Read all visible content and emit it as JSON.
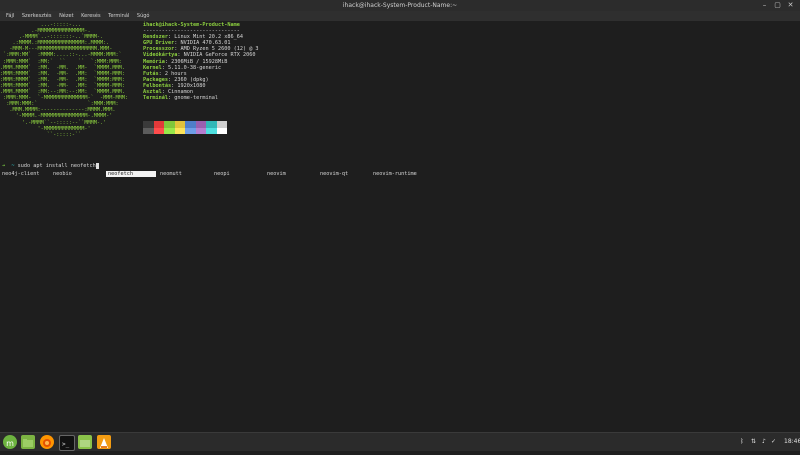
{
  "window": {
    "title": "ihack@ihack-System-Product-Name:~",
    "menu": [
      "Fájl",
      "Szerkesztés",
      "Nézet",
      "Keresés",
      "Terminál",
      "Súgó"
    ]
  },
  "neofetch": {
    "ascii_art": [
      "             ...-:::::-...",
      "          .-MMMMMMMMMMMMMMM-.",
      "      .-MMMM`..-:::::::-..`MMMM-.",
      "    .:MMMM.:MMMMMMMMMMMMMMM:.MMMM:.",
      "   -MMM-M---MMMMMMMMMMMMMMMMMMM.MMM-",
      " `:MMM:MM`  :MMMM:....::-...-MMMM:MMM:`",
      " :MMM:MMM`  :MM:`  ``    ``  `:MMM:MMM:",
      ".MMM.MMMM`  :MM.  -MM.  .MM-  `MMMM.MMM.",
      ":MMM:MMMM`  :MM.  -MM-  .MM:  `MMMM-MMM:",
      ":MMM:MMMM`  :MM.  -MM-  .MM:  `MMMM:MMM:",
      ":MMM:MMMM`  :MM.  -MM-  .MM:  `MMMM-MMM:",
      ".MMM.MMMM`  :MM:--:MM:--:MM:  `MMMM.MMM.",
      " :MMM:MMM-  `-MMMMMMMMMMMMMM-`  -MMM-MMM:",
      "  :MMM:MMM:`                `:MMM:MMM:",
      "   .MMM.MMMM:--------------:MMMM.MMM.",
      "     '-MMMM.-MMMMMMMMMMMMMMM-.MMMM-'",
      "       '.-MMMM``--:::::--``MMMM-.'",
      "            '-MMMMMMMMMMMMM-'",
      "               ``-:::::-``"
    ],
    "user_host": "ihack@ihack-System-Product-Name",
    "separator": "-------------------------------",
    "fields": [
      {
        "key": "Rendszer",
        "value": "Linux Mint 20.2 x86_64"
      },
      {
        "key": "GPU Driver",
        "value": "NVIDIA 470.63.01"
      },
      {
        "key": "Processzor",
        "value": "AMD Ryzen 5 2600 (12) @ 3"
      },
      {
        "key": "Videókártya",
        "value": "NVIDIA GeForce RTX 2060"
      },
      {
        "key": "Memória",
        "value": "2306MiB / 15928MiB"
      },
      {
        "key": "Kernel",
        "value": "5.11.0-38-generic"
      },
      {
        "key": "Futás",
        "value": "2 hours"
      },
      {
        "key": "Packages",
        "value": "2360 (dpkg)"
      },
      {
        "key": "Felbontás",
        "value": "1920x1080"
      },
      {
        "key": "Asztal",
        "value": "Cinnamon"
      },
      {
        "key": "Terminál",
        "value": "gnome-terminal"
      }
    ],
    "palette_top": [
      "#3a3a3a",
      "#e23a3a",
      "#7fc73b",
      "#e1c23a",
      "#4f7ec9",
      "#9a5fb0",
      "#31b8b8",
      "#cfcfcf"
    ],
    "palette_bottom": [
      "#5c5c5c",
      "#ff4c4c",
      "#98e84a",
      "#fbe35a",
      "#6f9ee8",
      "#b57ed0",
      "#4fe0e0",
      "#ffffff"
    ]
  },
  "prompt": {
    "arrow": "➜",
    "dir": "~",
    "command": "sudo apt install neofetch"
  },
  "completions": [
    "neo4j-client",
    "neobio",
    "neofetch",
    "neomutt",
    "neopi",
    "neovim",
    "neovim-qt",
    "neovim-runtime"
  ],
  "completion_selected": "neofetch",
  "panel": {
    "time": "18:46",
    "apps": [
      "menu-icon",
      "files-icon",
      "firefox-icon",
      "terminal-icon",
      "folder-icon",
      "vlc-icon"
    ]
  }
}
